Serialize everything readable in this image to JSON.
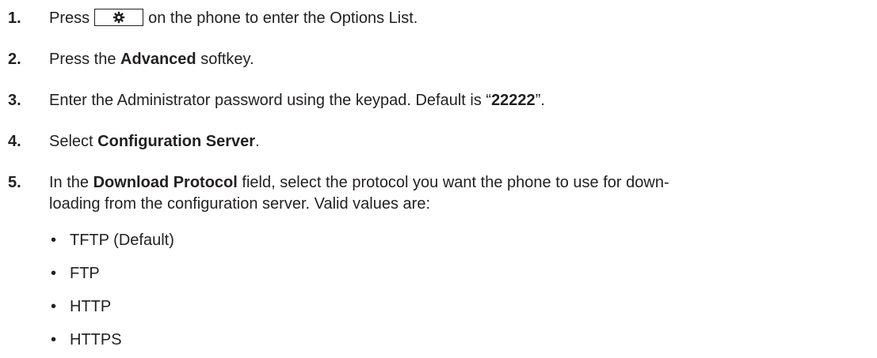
{
  "steps": [
    {
      "number": "1.",
      "pre": "Press",
      "icon": "gear-icon",
      "post": "on the phone to enter the Options List."
    },
    {
      "number": "2.",
      "pre": "Press the ",
      "bold": "Advanced",
      "post": " softkey."
    },
    {
      "number": "3.",
      "pre": "Enter the Administrator password using the keypad. Default is “",
      "bold": "22222",
      "post": "”."
    },
    {
      "number": "4.",
      "pre": "Select ",
      "bold": "Configuration Server",
      "post": "."
    },
    {
      "number": "5.",
      "pre": "In the ",
      "bold": "Download Protocol",
      "post_line1": " field, select the protocol you want the phone to use for down-",
      "line2": "loading from the configuration server. Valid values are:"
    }
  ],
  "bullet_char": "•",
  "valid_values": [
    "TFTP (Default)",
    "FTP",
    "HTTP",
    "HTTPS"
  ]
}
